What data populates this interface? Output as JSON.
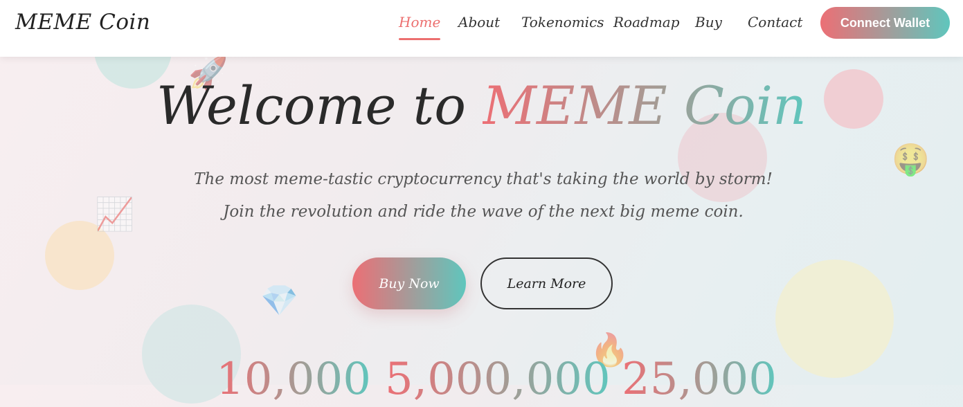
{
  "nav": {
    "logo": "MEME Coin",
    "items": [
      {
        "label": "Home",
        "active": true
      },
      {
        "label": "About",
        "active": false
      },
      {
        "label": "Tokenomics",
        "active": false
      },
      {
        "label": "Roadmap",
        "active": false
      },
      {
        "label": "Buy",
        "active": false
      },
      {
        "label": "Contact",
        "active": false
      }
    ],
    "connect_label": "Connect Wallet"
  },
  "hero": {
    "title_prefix": "Welcome to",
    "title_accent": "MEME Coin",
    "subtitle": "The most meme-tastic cryptocurrency that's taking the world by storm! Join the revolution and ride the wave of the next big meme coin.",
    "buy_label": "Buy Now",
    "learn_label": "Learn More"
  },
  "stats": [
    {
      "value": "10,000"
    },
    {
      "value": "5,000,000"
    },
    {
      "value": "25,000"
    }
  ],
  "decorations": {
    "rocket_icon": "🚀",
    "money_face_icon": "🤑",
    "chart_icon": "📈",
    "diamond_icon": "💎",
    "fire_icon": "🔥"
  },
  "colors": {
    "accent_pink": "#ec6f75",
    "accent_teal": "#5fc6bd",
    "text_dark": "#2a2a2a"
  }
}
